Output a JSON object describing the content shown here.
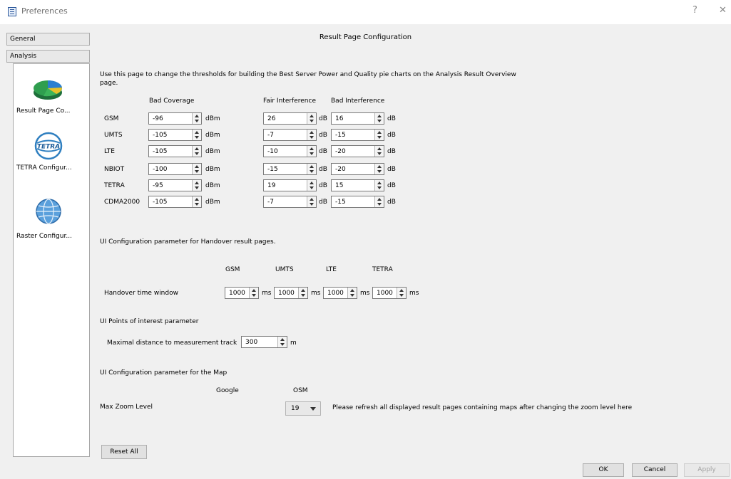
{
  "window": {
    "title": "Preferences",
    "help": "?",
    "close": "✕"
  },
  "nav": {
    "general": "General",
    "analysis": "Analysis",
    "items": [
      {
        "label": "Result Page Co...",
        "icon": "pie-chart-icon"
      },
      {
        "label": "TETRA Configur...",
        "icon": "tetra-logo-icon",
        "logo_text": "TETRA"
      },
      {
        "label": "Raster Configur...",
        "icon": "globe-icon"
      }
    ]
  },
  "page_title": "Result Page Configuration",
  "intro": "Use this page to change the thresholds for building the Best Server Power and Quality pie charts on the Analysis Result Overview page.",
  "thresholds": {
    "headers": {
      "bad_coverage": "Bad Coverage",
      "fair_interference": "Fair Interference",
      "bad_interference": "Bad Interference"
    },
    "rows": [
      {
        "tech": "GSM",
        "bad_coverage": "-96",
        "fair_interference": "26",
        "bad_interference": "16"
      },
      {
        "tech": "UMTS",
        "bad_coverage": "-105",
        "fair_interference": "-7",
        "bad_interference": "-15"
      },
      {
        "tech": "LTE",
        "bad_coverage": "-105",
        "fair_interference": "-10",
        "bad_interference": "-20"
      },
      {
        "tech": "NBIOT",
        "bad_coverage": "-100",
        "fair_interference": "-15",
        "bad_interference": "-20"
      },
      {
        "tech": "TETRA",
        "bad_coverage": "-95",
        "fair_interference": "19",
        "bad_interference": "15"
      },
      {
        "tech": "CDMA2000",
        "bad_coverage": "-105",
        "fair_interference": "-7",
        "bad_interference": "-15"
      }
    ],
    "unit_power": "dBm",
    "unit_db": "dB"
  },
  "handover": {
    "section_label": "UI Configuration parameter for Handover result pages.",
    "columns": [
      "GSM",
      "UMTS",
      "LTE",
      "TETRA"
    ],
    "row_label": "Handover time window",
    "values": [
      "1000",
      "1000",
      "1000",
      "1000"
    ],
    "unit": "ms"
  },
  "poi": {
    "section_label": "UI Points of interest parameter",
    "row_label": "Maximal distance to measurement track",
    "value": "300",
    "unit": "m"
  },
  "map": {
    "section_label": "UI Configuration parameter for the Map",
    "col_google": "Google",
    "col_osm": "OSM",
    "row_label": "Max Zoom Level",
    "osm_value": "19",
    "note": "Please refresh all displayed result pages containing maps after changing the zoom level here"
  },
  "buttons": {
    "reset_all": "Reset All",
    "ok": "OK",
    "cancel": "Cancel",
    "apply": "Apply"
  }
}
